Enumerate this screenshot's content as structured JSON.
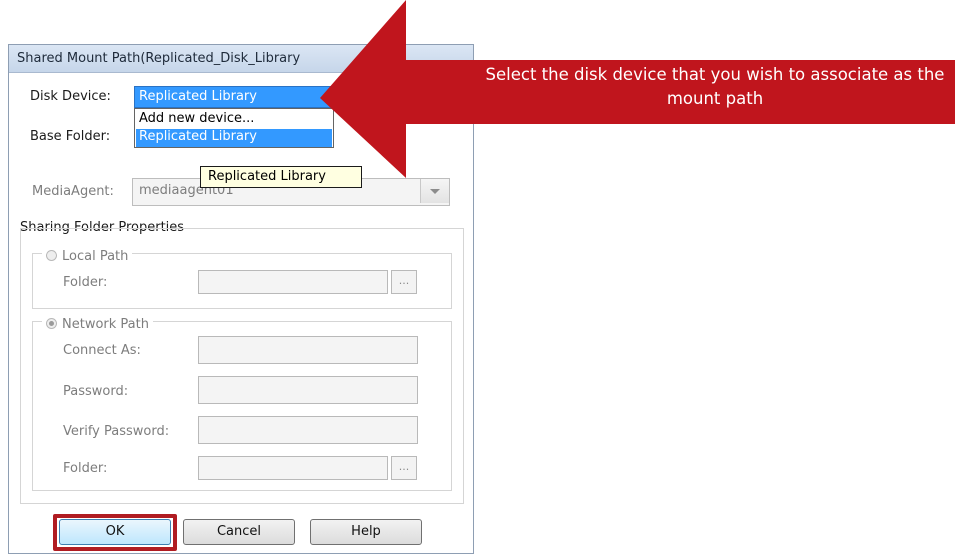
{
  "dialog": {
    "title": "Shared Mount Path(Replicated_Disk_Library"
  },
  "disk_device": {
    "label": "Disk Device:",
    "selected": "Replicated Library",
    "options": [
      "Add new device...",
      "Replicated Library"
    ]
  },
  "base_folder": {
    "label": "Base Folder:"
  },
  "tooltip": {
    "text": "Replicated Library"
  },
  "media_agent": {
    "label": "MediaAgent:",
    "value": "mediaagent01"
  },
  "sharing": {
    "title": "Sharing Folder Properties",
    "local_path": {
      "label": "Local Path",
      "folder_label": "Folder:",
      "browse": "..."
    },
    "network_path": {
      "label": "Network Path",
      "connect_as_label": "Connect As:",
      "password_label": "Password:",
      "verify_password_label": "Verify Password:",
      "folder_label": "Folder:",
      "browse": "..."
    }
  },
  "buttons": {
    "ok": "OK",
    "cancel": "Cancel",
    "help": "Help"
  },
  "callout": {
    "text": "Select the disk device that you wish to associate as the mount path",
    "color": "#c0151d"
  }
}
